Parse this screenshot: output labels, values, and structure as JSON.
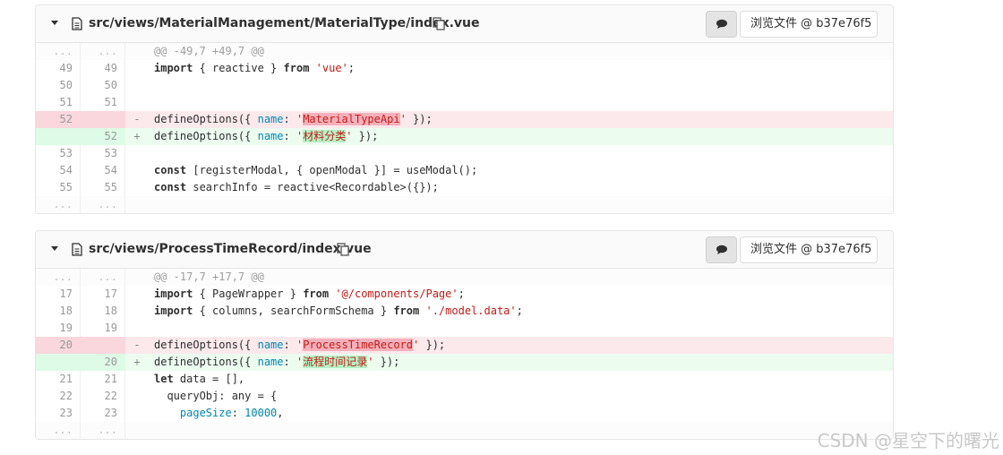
{
  "files": [
    {
      "path": "src/views/MaterialManagement/MaterialType/index.vue",
      "view_file_label": "浏览文件 @ b37e76f5",
      "hunk_header": "@@ -49,7 +49,7 @@",
      "lines": [
        {
          "type": "hunk",
          "old": "...",
          "new": "...",
          "sign": "",
          "code": "@@ -49,7 +49,7 @@"
        },
        {
          "type": "ctx",
          "old": "49",
          "new": "49",
          "sign": "",
          "code": "import { reactive } from 'vue';"
        },
        {
          "type": "ctx",
          "old": "50",
          "new": "50",
          "sign": "",
          "code": ""
        },
        {
          "type": "ctx",
          "old": "51",
          "new": "51",
          "sign": "",
          "code": ""
        },
        {
          "type": "del",
          "old": "52",
          "new": "",
          "sign": "-",
          "code": "defineOptions({ name: 'MaterialTypeApi' });"
        },
        {
          "type": "add",
          "old": "",
          "new": "52",
          "sign": "+",
          "code": "defineOptions({ name: '材料分类' });"
        },
        {
          "type": "ctx",
          "old": "53",
          "new": "53",
          "sign": "",
          "code": ""
        },
        {
          "type": "ctx",
          "old": "54",
          "new": "54",
          "sign": "",
          "code": "const [registerModal, { openModal }] = useModal();"
        },
        {
          "type": "ctx",
          "old": "55",
          "new": "55",
          "sign": "",
          "code": "const searchInfo = reactive<Recordable>({});"
        },
        {
          "type": "hunk",
          "old": "...",
          "new": "...",
          "sign": "",
          "code": ""
        }
      ]
    },
    {
      "path": "src/views/ProcessTimeRecord/index.vue",
      "view_file_label": "浏览文件 @ b37e76f5",
      "hunk_header": "@@ -17,7 +17,7 @@",
      "lines": [
        {
          "type": "hunk",
          "old": "...",
          "new": "...",
          "sign": "",
          "code": "@@ -17,7 +17,7 @@"
        },
        {
          "type": "ctx",
          "old": "17",
          "new": "17",
          "sign": "",
          "code": "import { PageWrapper } from '@/components/Page';"
        },
        {
          "type": "ctx",
          "old": "18",
          "new": "18",
          "sign": "",
          "code": "import { columns, searchFormSchema } from './model.data';"
        },
        {
          "type": "ctx",
          "old": "19",
          "new": "19",
          "sign": "",
          "code": ""
        },
        {
          "type": "del",
          "old": "20",
          "new": "",
          "sign": "-",
          "code": "defineOptions({ name: 'ProcessTimeRecord' });"
        },
        {
          "type": "add",
          "old": "",
          "new": "20",
          "sign": "+",
          "code": "defineOptions({ name: '流程时间记录' });"
        },
        {
          "type": "ctx",
          "old": "21",
          "new": "21",
          "sign": "",
          "code": "let data = [],"
        },
        {
          "type": "ctx",
          "old": "22",
          "new": "22",
          "sign": "",
          "code": "  queryObj: any = {"
        },
        {
          "type": "ctx",
          "old": "23",
          "new": "23",
          "sign": "",
          "code": "    pageSize: 10000,"
        },
        {
          "type": "hunk",
          "old": "...",
          "new": "...",
          "sign": "",
          "code": ""
        }
      ]
    }
  ],
  "watermark": "CSDN @星空下的曙光",
  "icons": {
    "toggle": "chevron-down-icon",
    "file": "file-icon",
    "copy": "copy-icon",
    "comment": "comment-icon"
  },
  "colors": {
    "del_bg": "#fbe9eb",
    "del_gutter": "#f9d7dc",
    "add_bg": "#ecfdf0",
    "add_gutter": "#ddfbe6",
    "string": "#c41a16"
  }
}
